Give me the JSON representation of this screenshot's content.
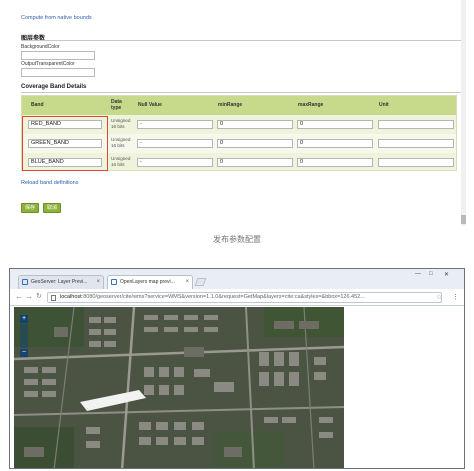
{
  "form": {
    "compute_link": "Compute from native bounds",
    "section_params": "图层参数",
    "bg_color_label": "BackgroundColor",
    "bg_color_value": "",
    "transparent_label": "OutputTransparentColor",
    "transparent_value": "",
    "coverage_title": "Coverage Band Details",
    "columns": [
      "Band",
      "Data type",
      "Null Value",
      "minRange",
      "maxRange",
      "Unit"
    ],
    "bands": [
      {
        "band": "RED_BAND",
        "dtype": "Unsigned 16 bits",
        "null": "-",
        "min": "0",
        "max": "0",
        "unit": ""
      },
      {
        "band": "GREEN_BAND",
        "dtype": "Unsigned 16 bits",
        "null": "-",
        "min": "0",
        "max": "0",
        "unit": ""
      },
      {
        "band": "BLUE_BAND",
        "dtype": "Unsigned 16 bits",
        "null": "-",
        "min": "0",
        "max": "0",
        "unit": ""
      }
    ],
    "reload_link": "Reload band definitions",
    "save_label": "保存",
    "cancel_label": "取消"
  },
  "caption": "发布参数配置",
  "browser": {
    "tabs": [
      {
        "title": "GeoServer: Layer Previ..."
      },
      {
        "title": "OpenLayers map previ..."
      }
    ],
    "url_host": "localhost",
    "url_rest": ":8080/geoserver/cite/wms?service=WMS&version=1.1.0&request=GetMap&layers=cite:ca&styles=&bbox=126.452...",
    "minimize": "—",
    "maximize": "□",
    "close": "✕"
  },
  "colors": {
    "table_header": "#c7d98b",
    "highlight_box": "#e2462f",
    "button_green": "#8db13b",
    "link_blue": "#2a5db0"
  }
}
